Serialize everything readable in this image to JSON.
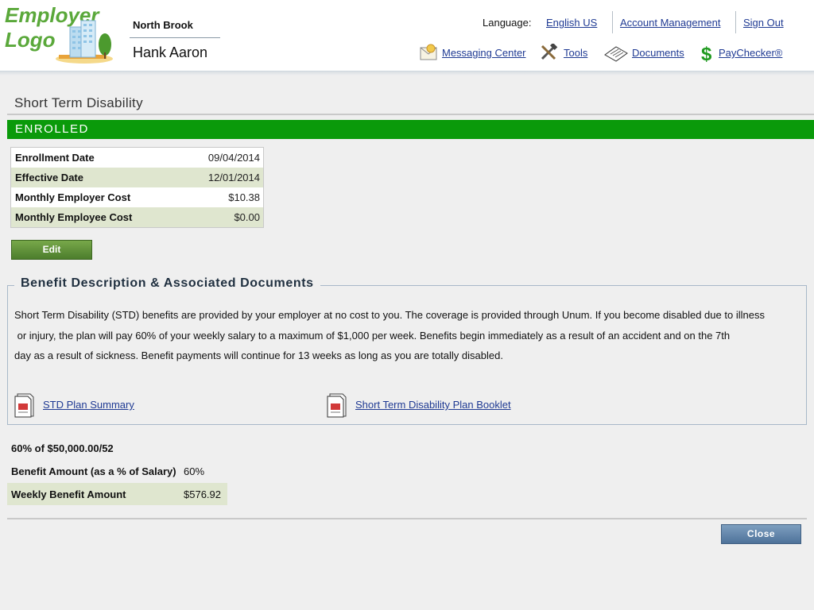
{
  "header": {
    "logo_line1": "Employer",
    "logo_line2": "Logo",
    "company": "North Brook",
    "user_name": "Hank Aaron",
    "language_label": "Language:",
    "language_value": "English US",
    "account_management": "Account Management",
    "sign_out": "Sign Out",
    "nav": {
      "messaging_center": "Messaging Center",
      "tools": "Tools",
      "documents": "Documents",
      "paychecker": "PayChecker®"
    }
  },
  "page": {
    "title": "Short Term Disability",
    "status": "ENROLLED"
  },
  "enrollment": {
    "rows": [
      {
        "label": "Enrollment Date",
        "value": "09/04/2014"
      },
      {
        "label": "Effective Date",
        "value": "12/01/2014"
      },
      {
        "label": "Monthly Employer Cost",
        "value": "$10.38"
      },
      {
        "label": "Monthly Employee Cost",
        "value": "$0.00"
      }
    ],
    "edit_label": "Edit"
  },
  "benefit": {
    "section_title": "Benefit Description & Associated Documents",
    "description_line1": "Short Term Disability (STD) benefits are provided by your employer at no cost to you. The coverage is provided through Unum. If you become disabled due to illness",
    "description_line2": " or injury, the plan will pay 60% of your weekly salary to a maximum of $1,000 per week. Benefits begin immediately as a result of an accident and on the 7th",
    "description_line3": "day as a result of sickness. Benefit payments will continue for 13 weeks as long as you are totally disabled.",
    "documents": [
      {
        "label": "STD Plan Summary"
      },
      {
        "label": "Short Term Disability Plan Booklet"
      }
    ]
  },
  "calculation": {
    "formula": "60% of $50,000.00/52",
    "rows": [
      {
        "label": "Benefit Amount (as a % of Salary)",
        "value": "60%"
      },
      {
        "label": "Weekly Benefit Amount",
        "value": "$576.92"
      }
    ]
  },
  "footer": {
    "close_label": "Close"
  },
  "colors": {
    "enrolled_bar": "#0a9a0a",
    "link": "#1f3a93",
    "row_alt": "#dfe6cf",
    "logo_green": "#5aa83a"
  }
}
